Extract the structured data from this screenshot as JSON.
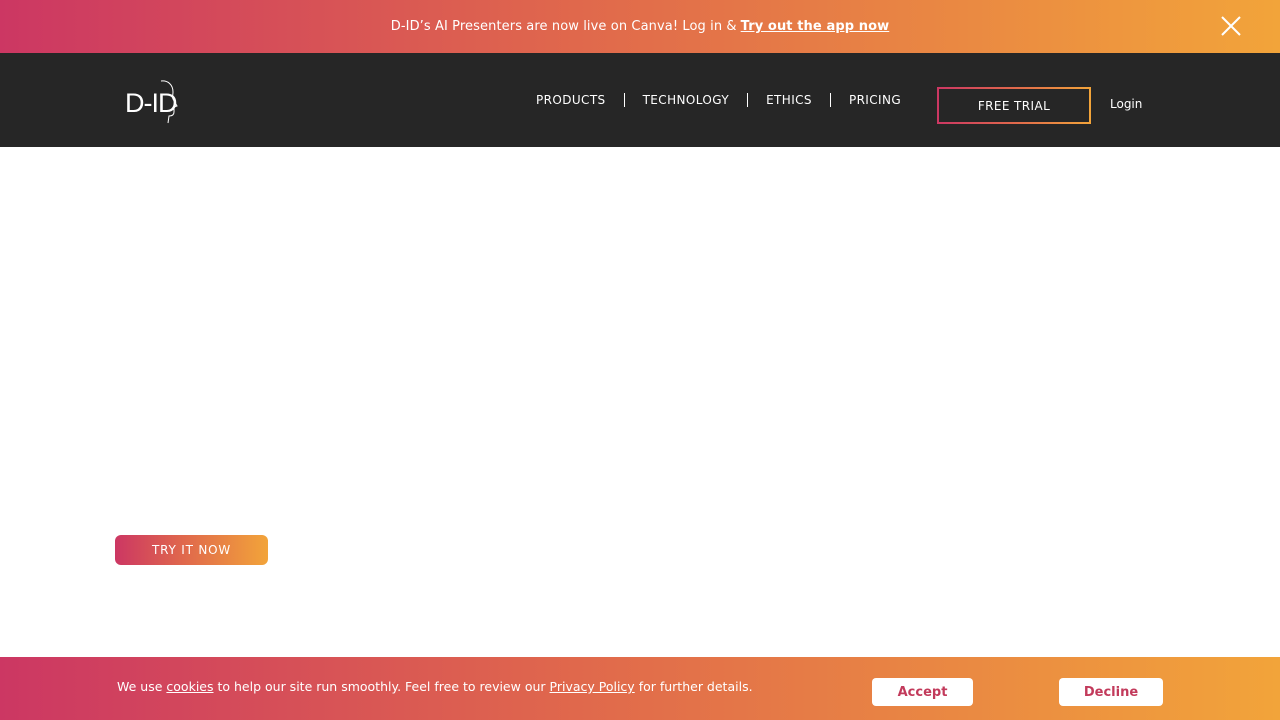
{
  "banner": {
    "text": "D-ID’s AI Presenters are now live on Canva! Log in &",
    "link": "Try out the app now"
  },
  "nav": {
    "logo_text": "D-ID",
    "links": [
      "PRODUCTS",
      "TECHNOLOGY",
      "ETHICS",
      "PRICING"
    ],
    "free_trial": "FREE TRIAL",
    "login": "Login"
  },
  "hero": {
    "cta": "TRY IT NOW"
  },
  "cookie": {
    "prefix": "We use",
    "cookies_link": "cookies",
    "middle": "to help our site run smoothly. Feel free to review our",
    "policy_link": "Privacy Policy",
    "suffix": "for further details.",
    "accept": "Accept",
    "decline": "Decline"
  },
  "colors": {
    "gradient_start": "#cc3763",
    "gradient_end": "#f2a43a",
    "nav_bg": "#262626",
    "button_text": "#c23a5b"
  },
  "icons": {
    "close": "close-icon",
    "logo": "d-id-face-logo"
  }
}
